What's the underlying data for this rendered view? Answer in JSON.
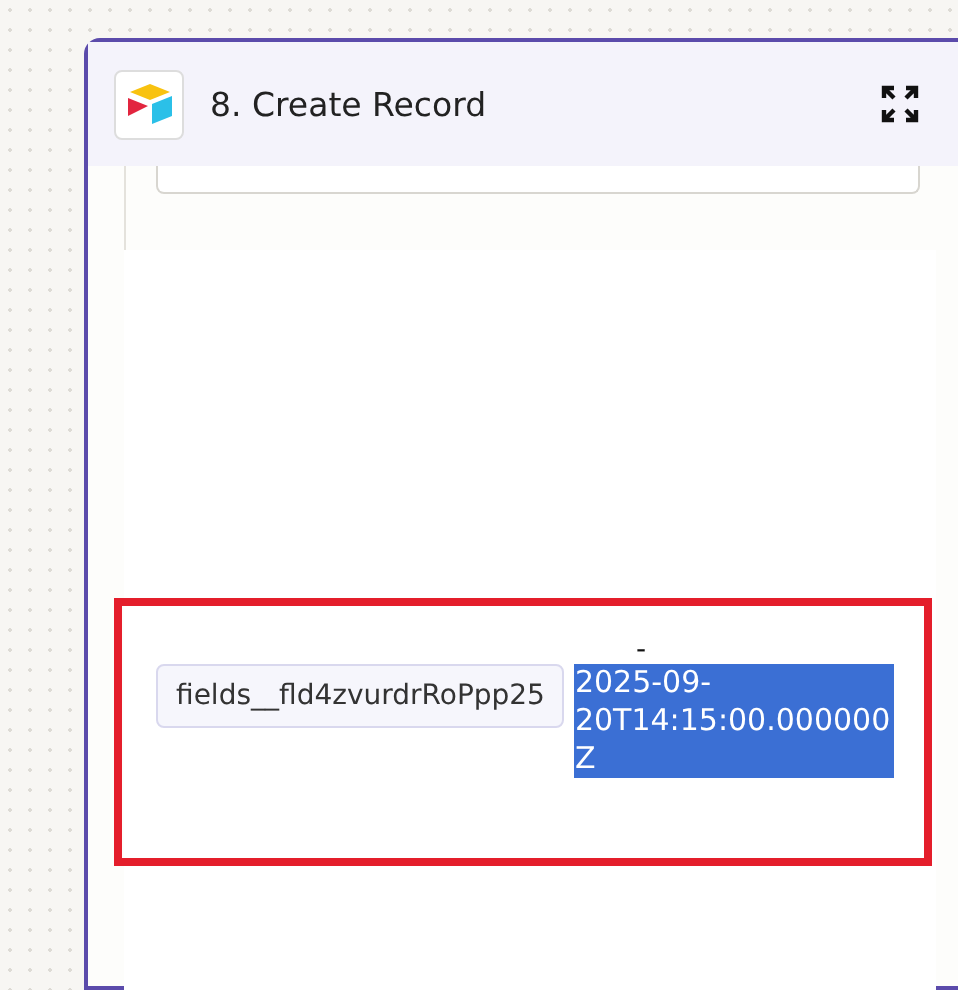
{
  "step": {
    "title": "8. Create Record"
  },
  "mapping": {
    "field": "fields__fld4zvurdrRoPpp25",
    "separator": "-",
    "value": "2025-09-20T14:15:00.000000Z",
    "selected": true,
    "highlighted": true
  }
}
